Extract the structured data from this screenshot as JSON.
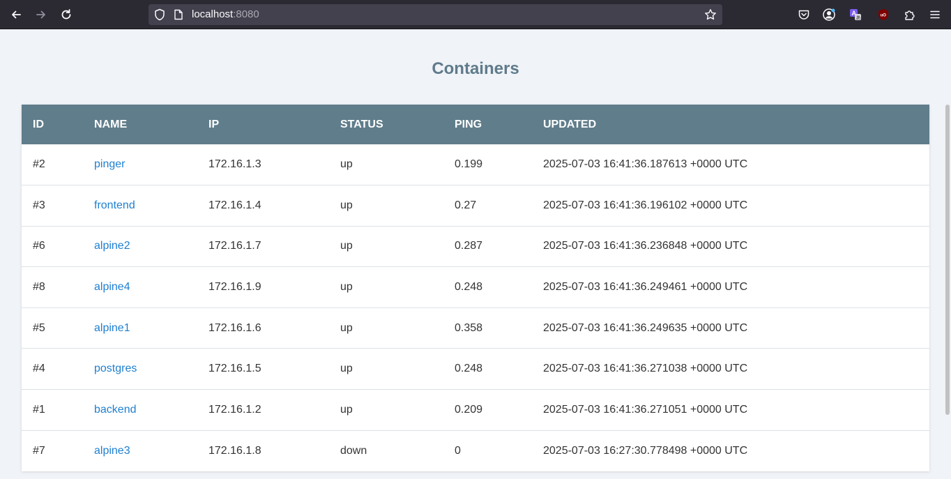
{
  "browser": {
    "url_host": "localhost",
    "url_port": ":8080"
  },
  "page": {
    "title": "Containers"
  },
  "table": {
    "headers": [
      "ID",
      "NAME",
      "IP",
      "STATUS",
      "PING",
      "UPDATED"
    ],
    "rows": [
      {
        "id": "#2",
        "name": "pinger",
        "ip": "172.16.1.3",
        "status": "up",
        "ping": "0.199",
        "updated": "2025-07-03 16:41:36.187613 +0000 UTC"
      },
      {
        "id": "#3",
        "name": "frontend",
        "ip": "172.16.1.4",
        "status": "up",
        "ping": "0.27",
        "updated": "2025-07-03 16:41:36.196102 +0000 UTC"
      },
      {
        "id": "#6",
        "name": "alpine2",
        "ip": "172.16.1.7",
        "status": "up",
        "ping": "0.287",
        "updated": "2025-07-03 16:41:36.236848 +0000 UTC"
      },
      {
        "id": "#8",
        "name": "alpine4",
        "ip": "172.16.1.9",
        "status": "up",
        "ping": "0.248",
        "updated": "2025-07-03 16:41:36.249461 +0000 UTC"
      },
      {
        "id": "#5",
        "name": "alpine1",
        "ip": "172.16.1.6",
        "status": "up",
        "ping": "0.358",
        "updated": "2025-07-03 16:41:36.249635 +0000 UTC"
      },
      {
        "id": "#4",
        "name": "postgres",
        "ip": "172.16.1.5",
        "status": "up",
        "ping": "0.248",
        "updated": "2025-07-03 16:41:36.271038 +0000 UTC"
      },
      {
        "id": "#1",
        "name": "backend",
        "ip": "172.16.1.2",
        "status": "up",
        "ping": "0.209",
        "updated": "2025-07-03 16:41:36.271051 +0000 UTC"
      },
      {
        "id": "#7",
        "name": "alpine3",
        "ip": "172.16.1.8",
        "status": "down",
        "ping": "0",
        "updated": "2025-07-03 16:27:30.778498 +0000 UTC"
      }
    ]
  },
  "colors": {
    "header_bg": "#607d8b",
    "title": "#5f7b8c",
    "link": "#1e7fd0",
    "page_bg": "#f0f3f7"
  }
}
